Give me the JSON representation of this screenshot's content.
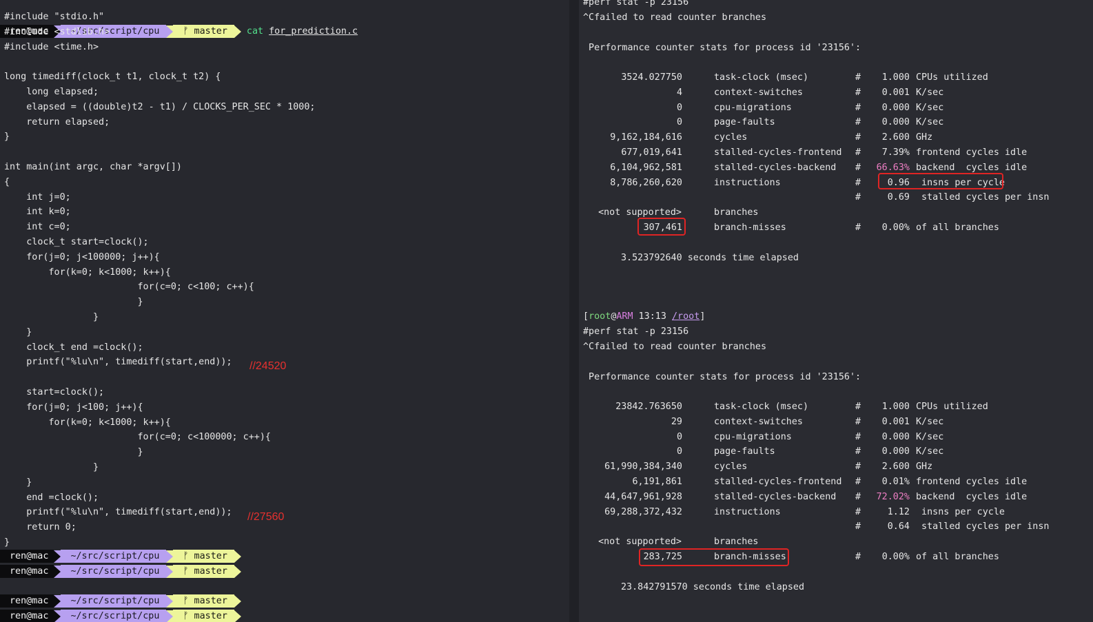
{
  "left": {
    "top_prompt": {
      "user": "ren@mac",
      "path": "~/src/script/cpu",
      "branch_icon": "git-branch-icon",
      "branch": "master",
      "cmd": "cat",
      "arg": "for_prediction.c"
    },
    "code": [
      "#include \"stdio.h\"",
      "#include <stdlib.h>",
      "#include <time.h>",
      "",
      "long timediff(clock_t t1, clock_t t2) {",
      "    long elapsed;",
      "    elapsed = ((double)t2 - t1) / CLOCKS_PER_SEC * 1000;",
      "    return elapsed;",
      "}",
      "",
      "int main(int argc, char *argv[])",
      "{",
      "    int j=0;",
      "    int k=0;",
      "    int c=0;",
      "    clock_t start=clock();",
      "    for(j=0; j<100000; j++){",
      "        for(k=0; k<1000; k++){",
      "                        for(c=0; c<100; c++){",
      "                        }",
      "                }",
      "    }",
      "    clock_t end =clock();",
      "    printf(\"%lu\\n\", timediff(start,end));",
      "",
      "    start=clock();",
      "    for(j=0; j<100; j++){",
      "        for(k=0; k<1000; k++){",
      "                        for(c=0; c<100000; c++){",
      "                        }",
      "                }",
      "    }",
      "    end =clock();",
      "    printf(\"%lu\\n\", timediff(start,end));",
      "    return 0;",
      "}"
    ],
    "annotation1": "//24520",
    "annotation2": "//27560",
    "prompts": [
      {
        "user": "ren@mac",
        "path": "~/src/script/cpu",
        "branch": "master"
      },
      {
        "user": "ren@mac",
        "path": "~/src/script/cpu",
        "branch": "master"
      },
      {
        "user": "ren@mac",
        "path": "~/src/script/cpu",
        "branch": "master"
      },
      {
        "user": "ren@mac",
        "path": "~/src/script/cpu",
        "branch": "master"
      }
    ]
  },
  "right": {
    "block1": {
      "cmd": "#perf stat -p 23156",
      "err": "^Cfailed to read counter branches",
      "header": " Performance counter stats for process id '23156':",
      "rows": [
        {
          "val": "3524.027750",
          "name": "task-clock (msec)",
          "hash": "#",
          "pct": "1.000",
          "desc": "CPUs utilized"
        },
        {
          "val": "4",
          "name": "context-switches",
          "hash": "#",
          "pct": "0.001",
          "desc": "K/sec"
        },
        {
          "val": "0",
          "name": "cpu-migrations",
          "hash": "#",
          "pct": "0.000",
          "desc": "K/sec"
        },
        {
          "val": "0",
          "name": "page-faults",
          "hash": "#",
          "pct": "0.000",
          "desc": "K/sec"
        },
        {
          "val": "9,162,184,616",
          "name": "cycles",
          "hash": "#",
          "pct": "2.600",
          "desc": "GHz"
        },
        {
          "val": "677,019,641",
          "name": "stalled-cycles-frontend",
          "hash": "#",
          "pct": "7.39%",
          "desc": "frontend cycles idle"
        },
        {
          "val": "6,104,962,581",
          "name": "stalled-cycles-backend",
          "hash": "#",
          "pct": "66.63%",
          "desc": "backend  cycles idle",
          "pct_color": "pink"
        },
        {
          "val": "8,786,260,620",
          "name": "instructions",
          "hash": "#",
          "pct": "0.96",
          "desc": " insns per cycle"
        },
        {
          "val": "",
          "name": "",
          "hash": "#",
          "pct": "0.69",
          "desc": " stalled cycles per insn"
        },
        {
          "val": "<not supported>",
          "name": "branches",
          "hash": "",
          "pct": "",
          "desc": ""
        },
        {
          "val": "307,461",
          "name": "branch-misses",
          "hash": "#",
          "pct": "0.00%",
          "desc": "of all branches"
        }
      ],
      "elapsed": "3.523792640 seconds time elapsed"
    },
    "prompt2": {
      "open": "[",
      "user": "root",
      "at": "@",
      "host": "ARM",
      "time": "13:13",
      "dir": "/root",
      "close": "]"
    },
    "block2": {
      "cmd": "#perf stat -p 23156",
      "err": "^Cfailed to read counter branches",
      "header": " Performance counter stats for process id '23156':",
      "rows": [
        {
          "val": "23842.763650",
          "name": "task-clock (msec)",
          "hash": "#",
          "pct": "1.000",
          "desc": "CPUs utilized"
        },
        {
          "val": "29",
          "name": "context-switches",
          "hash": "#",
          "pct": "0.001",
          "desc": "K/sec"
        },
        {
          "val": "0",
          "name": "cpu-migrations",
          "hash": "#",
          "pct": "0.000",
          "desc": "K/sec"
        },
        {
          "val": "0",
          "name": "page-faults",
          "hash": "#",
          "pct": "0.000",
          "desc": "K/sec"
        },
        {
          "val": "61,990,384,340",
          "name": "cycles",
          "hash": "#",
          "pct": "2.600",
          "desc": "GHz"
        },
        {
          "val": "6,191,861",
          "name": "stalled-cycles-frontend",
          "hash": "#",
          "pct": "0.01%",
          "desc": "frontend cycles idle"
        },
        {
          "val": "44,647,961,928",
          "name": "stalled-cycles-backend",
          "hash": "#",
          "pct": "72.02%",
          "desc": "backend  cycles idle",
          "pct_color": "pink"
        },
        {
          "val": "69,288,372,432",
          "name": "instructions",
          "hash": "#",
          "pct": "1.12",
          "desc": " insns per cycle"
        },
        {
          "val": "",
          "name": "",
          "hash": "#",
          "pct": "0.64",
          "desc": " stalled cycles per insn"
        },
        {
          "val": "<not supported>",
          "name": "branches",
          "hash": "",
          "pct": "",
          "desc": ""
        },
        {
          "val": "283,725",
          "name": "branch-misses",
          "hash": "#",
          "pct": "0.00%",
          "desc": "of all branches"
        }
      ],
      "elapsed": "23.842791570 seconds time elapsed"
    }
  }
}
